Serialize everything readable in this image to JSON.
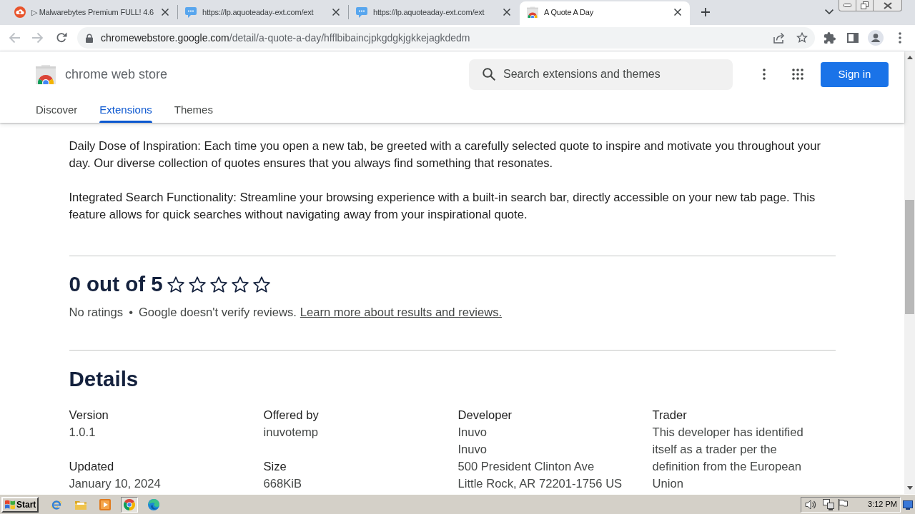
{
  "browser": {
    "tabs": [
      {
        "kind": "cloud",
        "title": "▷ Malwarebytes Premium FULL! 4.6",
        "selected": false
      },
      {
        "kind": "bubble",
        "title": "https://lp.aquoteaday-ext.com/ext",
        "selected": false
      },
      {
        "kind": "bubble",
        "title": "https://lp.aquoteaday-ext.com/ext",
        "selected": false
      },
      {
        "kind": "store",
        "title": "A Quote A Day",
        "selected": true
      }
    ],
    "nav_buttons": [
      {
        "kind": "back",
        "disabled": true
      },
      {
        "kind": "forward",
        "disabled": true
      },
      {
        "kind": "reload",
        "disabled": false
      }
    ],
    "address_bar": {
      "host": "chromewebstore.google.com",
      "path": "/detail/a-quote-a-day/hfflbibaincjpkgdgkjgkkejagkdedm"
    }
  },
  "store_header": {
    "title": "chrome web store",
    "search": {
      "placeholder": "Search extensions and themes"
    },
    "sign_in": "Sign in",
    "nav": [
      {
        "label": "Discover",
        "selected": false
      },
      {
        "label": "Extensions",
        "selected": true
      },
      {
        "label": "Themes",
        "selected": false
      }
    ]
  },
  "description": [
    "Daily Dose of Inspiration: Each time you open a new tab, be greeted with a carefully selected quote to inspire and motivate you throughout your day. Our diverse collection of quotes ensures that you always find something that resonates.",
    "Integrated Search Functionality: Streamline your browsing experience with a built-in search bar, directly accessible on your new tab page. This feature allows for quick searches without navigating away from your inspirational quote."
  ],
  "ratings": {
    "heading": "0 out of 5",
    "stars": 0,
    "count": "No ratings",
    "separator": "•",
    "note": "Google doesn't verify reviews.",
    "link": "Learn more about results and reviews."
  },
  "details": {
    "title": "Details",
    "columns": [
      {
        "fields": [
          {
            "label": "Version",
            "lines": [
              "1.0.1"
            ]
          },
          {
            "label": "Updated",
            "lines": [
              "January 10, 2024"
            ]
          }
        ]
      },
      {
        "fields": [
          {
            "label": "Offered by",
            "lines": [
              "inuvotemp"
            ]
          },
          {
            "label": "Size",
            "lines": [
              "668KiB"
            ]
          }
        ]
      },
      {
        "fields": [
          {
            "label": "Developer",
            "lines": [
              "Inuvo",
              "Inuvo",
              "500 President Clinton Ave",
              "Little Rock, AR 72201-1756 US"
            ]
          }
        ]
      },
      {
        "fields": [
          {
            "label": "Trader",
            "lines": [
              "This developer has identified itself as a trader per the definition from the European Union"
            ]
          }
        ]
      }
    ]
  },
  "taskbar": {
    "start": "Start",
    "apps": [
      {
        "kind": "ie",
        "selected": false
      },
      {
        "kind": "folder",
        "selected": false
      },
      {
        "kind": "media",
        "selected": false
      },
      {
        "kind": "chrome",
        "selected": true
      },
      {
        "kind": "edge",
        "selected": false
      }
    ],
    "clock": "3:12 PM"
  }
}
